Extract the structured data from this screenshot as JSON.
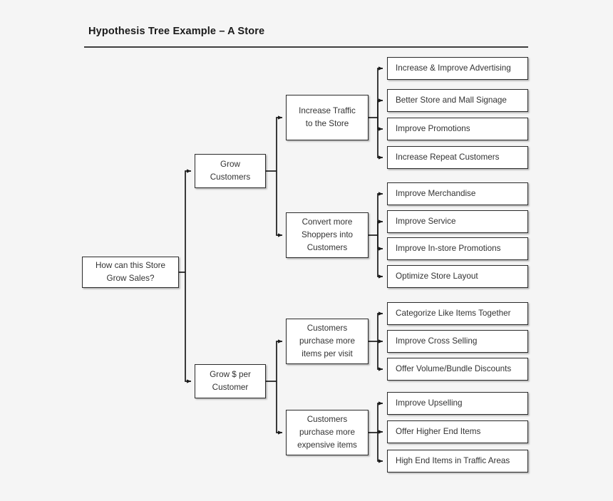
{
  "header": {
    "title": "Hypothesis Tree Example – A Store"
  },
  "colors": {
    "background": "#f5f5f5",
    "node_fill": "#ffffff",
    "node_border": "#2b2b2b",
    "connector": "#1a1a1a",
    "title_text": "#1a1a1a",
    "node_text": "#333333",
    "rule": "#3f3f3f"
  },
  "chart_data": {
    "type": "diagram",
    "subtype": "hypothesis-tree",
    "title": "Hypothesis Tree Example – A Store",
    "orientation": "left-to-right",
    "levels": 4,
    "root": "How can this Store\nGrow Sales?",
    "nodes": [
      {
        "id": "root",
        "label": "How can this Store\nGrow Sales?",
        "level": 0,
        "parent": null
      },
      {
        "id": "l1a",
        "label": "Grow\nCustomers",
        "level": 1,
        "parent": "root"
      },
      {
        "id": "l1b",
        "label": "Grow $ per\nCustomer",
        "level": 1,
        "parent": "root"
      },
      {
        "id": "l2a",
        "label": "Increase Traffic\nto the Store",
        "level": 2,
        "parent": "l1a"
      },
      {
        "id": "l2b",
        "label": "Convert more\nShoppers into\nCustomers",
        "level": 2,
        "parent": "l1a"
      },
      {
        "id": "l2c",
        "label": "Customers\npurchase more\nitems per visit",
        "level": 2,
        "parent": "l1b"
      },
      {
        "id": "l2d",
        "label": "Customers\npurchase more\nexpensive items",
        "level": 2,
        "parent": "l1b"
      },
      {
        "id": "l3a1",
        "label": "Increase & Improve Advertising",
        "level": 3,
        "parent": "l2a"
      },
      {
        "id": "l3a2",
        "label": "Better Store and Mall Signage",
        "level": 3,
        "parent": "l2a"
      },
      {
        "id": "l3a3",
        "label": "Improve Promotions",
        "level": 3,
        "parent": "l2a"
      },
      {
        "id": "l3a4",
        "label": "Increase Repeat Customers",
        "level": 3,
        "parent": "l2a"
      },
      {
        "id": "l3b1",
        "label": "Improve Merchandise",
        "level": 3,
        "parent": "l2b"
      },
      {
        "id": "l3b2",
        "label": "Improve Service",
        "level": 3,
        "parent": "l2b"
      },
      {
        "id": "l3b3",
        "label": "Improve In-store Promotions",
        "level": 3,
        "parent": "l2b"
      },
      {
        "id": "l3b4",
        "label": "Optimize Store Layout",
        "level": 3,
        "parent": "l2b"
      },
      {
        "id": "l3c1",
        "label": "Categorize Like Items Together",
        "level": 3,
        "parent": "l2c"
      },
      {
        "id": "l3c2",
        "label": "Improve Cross Selling",
        "level": 3,
        "parent": "l2c"
      },
      {
        "id": "l3c3",
        "label": "Offer Volume/Bundle Discounts",
        "level": 3,
        "parent": "l2c"
      },
      {
        "id": "l3d1",
        "label": "Improve Upselling",
        "level": 3,
        "parent": "l2d"
      },
      {
        "id": "l3d2",
        "label": "Offer Higher End Items",
        "level": 3,
        "parent": "l2d"
      },
      {
        "id": "l3d3",
        "label": "High End Items in Traffic Areas",
        "level": 3,
        "parent": "l2d"
      }
    ],
    "edges": [
      {
        "from": "root",
        "to": "l1a"
      },
      {
        "from": "root",
        "to": "l1b"
      },
      {
        "from": "l1a",
        "to": "l2a"
      },
      {
        "from": "l1a",
        "to": "l2b"
      },
      {
        "from": "l1b",
        "to": "l2c"
      },
      {
        "from": "l1b",
        "to": "l2d"
      },
      {
        "from": "l2a",
        "to": "l3a1"
      },
      {
        "from": "l2a",
        "to": "l3a2"
      },
      {
        "from": "l2a",
        "to": "l3a3"
      },
      {
        "from": "l2a",
        "to": "l3a4"
      },
      {
        "from": "l2b",
        "to": "l3b1"
      },
      {
        "from": "l2b",
        "to": "l3b2"
      },
      {
        "from": "l2b",
        "to": "l3b3"
      },
      {
        "from": "l2b",
        "to": "l3b4"
      },
      {
        "from": "l2c",
        "to": "l3c1"
      },
      {
        "from": "l2c",
        "to": "l3c2"
      },
      {
        "from": "l2c",
        "to": "l3c3"
      },
      {
        "from": "l2d",
        "to": "l3d1"
      },
      {
        "from": "l2d",
        "to": "l3d2"
      },
      {
        "from": "l2d",
        "to": "l3d3"
      }
    ]
  },
  "tree": {
    "root": {
      "label": "How can this Store\nGrow Sales?"
    },
    "branches": [
      {
        "label": "Grow\nCustomers",
        "children": [
          {
            "label": "Increase Traffic\nto the Store",
            "leaves": [
              "Increase & Improve Advertising",
              "Better Store and Mall Signage",
              "Improve Promotions",
              "Increase Repeat Customers"
            ]
          },
          {
            "label": "Convert more\nShoppers into\nCustomers",
            "leaves": [
              "Improve Merchandise",
              "Improve Service",
              "Improve In-store Promotions",
              "Optimize Store Layout"
            ]
          }
        ]
      },
      {
        "label": "Grow $ per\nCustomer",
        "children": [
          {
            "label": "Customers\npurchase more\nitems per visit",
            "leaves": [
              "Categorize Like Items Together",
              "Improve Cross Selling",
              "Offer Volume/Bundle Discounts"
            ]
          },
          {
            "label": "Customers\npurchase more\nexpensive items",
            "leaves": [
              "Improve Upselling",
              "Offer Higher End Items",
              "High End Items in Traffic Areas"
            ]
          }
        ]
      }
    ]
  }
}
